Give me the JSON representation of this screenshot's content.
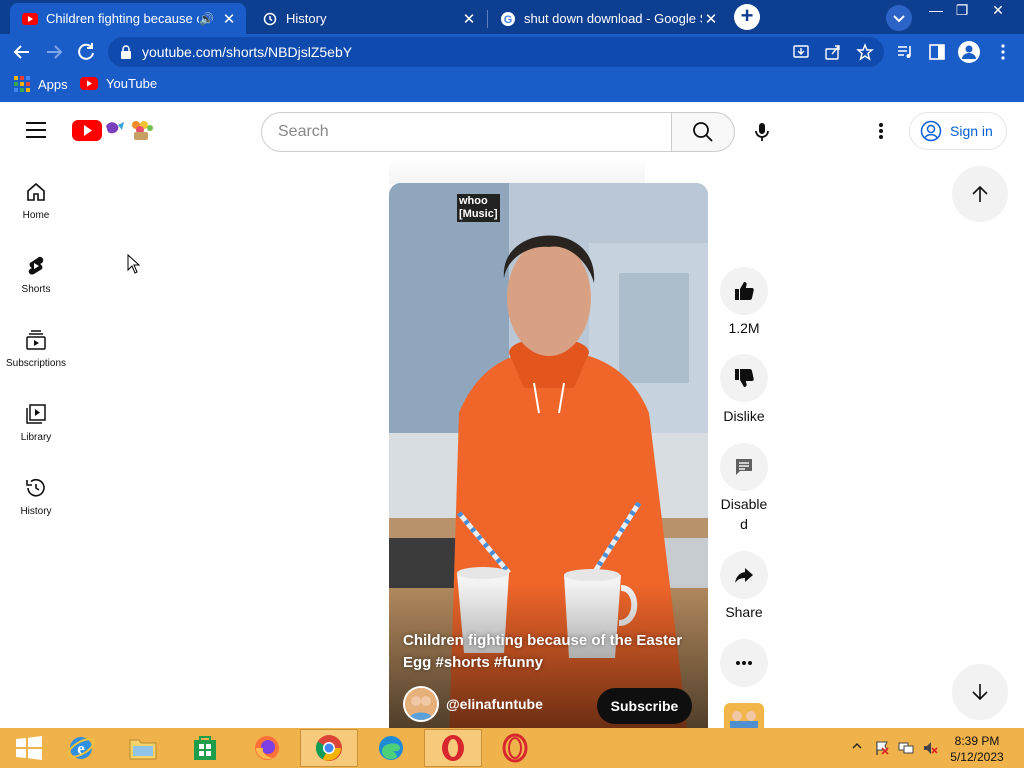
{
  "browser": {
    "tabs": [
      {
        "title": "Children fighting because of the Easter Egg",
        "active": true,
        "audio": true
      },
      {
        "title": "History",
        "active": false
      },
      {
        "title": "shut down download - Google Search",
        "active": false
      }
    ],
    "address": "youtube.com/shorts/NBDjslZ5ebY",
    "bookmarks": [
      {
        "label": "Apps"
      },
      {
        "label": "YouTube"
      }
    ]
  },
  "youtube": {
    "search_placeholder": "Search",
    "sign_in_label": "Sign in",
    "guide": [
      {
        "label": "Home",
        "icon": "home-icon"
      },
      {
        "label": "Shorts",
        "icon": "shorts-icon"
      },
      {
        "label": "Subscriptions",
        "icon": "subscriptions-icon"
      },
      {
        "label": "Library",
        "icon": "library-icon"
      },
      {
        "label": "History",
        "icon": "history-icon"
      }
    ],
    "short": {
      "music_tag_line1": "whoo",
      "music_tag_line2": "[Music]",
      "title_line1": "Children fighting because of the Easter",
      "title_line2": "Egg #shorts #funny",
      "channel": "@elinafuntube",
      "subscribe_label": "Subscribe"
    },
    "actions": {
      "like_count": "1.2M",
      "dislike_label": "Dislike",
      "comments_line1": "Disable",
      "comments_line2": "d",
      "share_label": "Share"
    }
  },
  "taskbar": {
    "time": "8:39 PM",
    "date": "5/12/2023",
    "accent": "#f0b24b"
  }
}
